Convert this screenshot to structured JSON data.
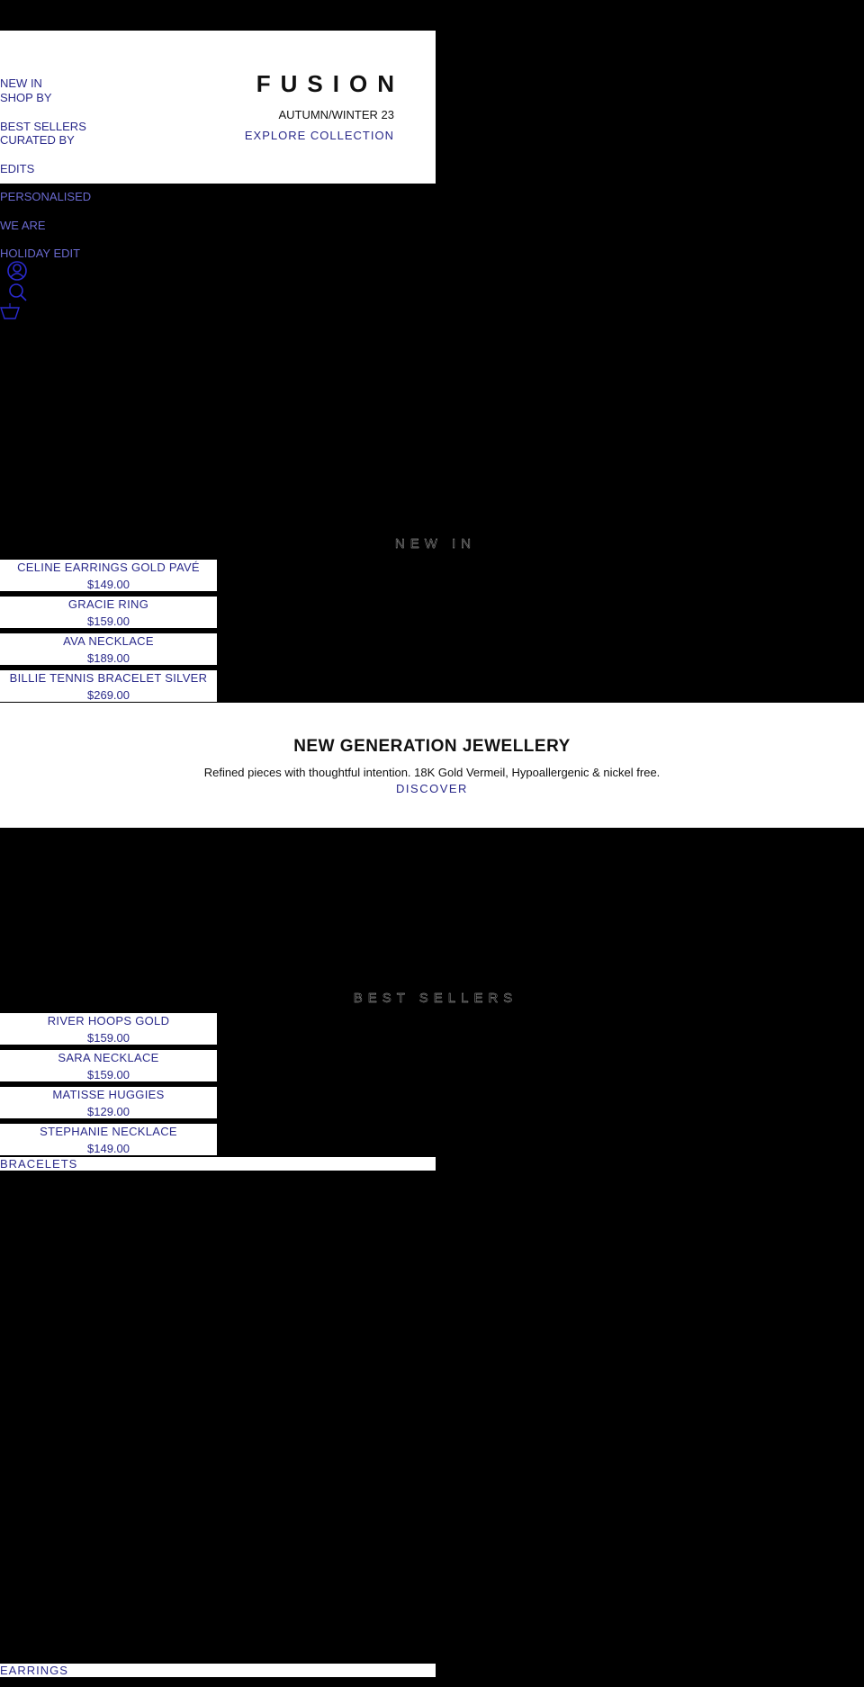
{
  "nav": {
    "items": [
      "NEW IN",
      "SHOP BY",
      "BEST SELLERS",
      "CURATED BY",
      "EDITS",
      "PERSONALISED",
      "WE ARE",
      "HOLIDAY EDIT"
    ]
  },
  "header": {
    "logo": "FUSION",
    "season": "AUTUMN/WINTER 23",
    "cta": "EXPLORE COLLECTION"
  },
  "icons": [
    "account-icon",
    "search-icon",
    "basket-icon"
  ],
  "new_in": {
    "title": "NEW IN",
    "products": [
      {
        "name": "CELINE EARRINGS GOLD PAVÉ",
        "price": "$149.00"
      },
      {
        "name": "GRACIE RING",
        "price": "$159.00"
      },
      {
        "name": "AVA NECKLACE",
        "price": "$189.00"
      },
      {
        "name": "BILLIE TENNIS BRACELET SILVER",
        "price": "$269.00"
      }
    ]
  },
  "banner": {
    "title": "NEW GENERATION JEWELLERY",
    "text": "Refined pieces with thoughtful intention. 18K Gold Vermeil, Hypoallergenic & nickel free.",
    "cta": "DISCOVER"
  },
  "best_sellers": {
    "title": "BEST SELLERS",
    "products": [
      {
        "name": "RIVER HOOPS GOLD",
        "price": "$159.00"
      },
      {
        "name": "SARA NECKLACE",
        "price": "$159.00"
      },
      {
        "name": "MATISSE HUGGIES",
        "price": "$129.00"
      },
      {
        "name": "STEPHANIE NECKLACE",
        "price": "$149.00"
      }
    ]
  },
  "categories": [
    "BRACELETS",
    "EARRINGS"
  ],
  "colors": {
    "link": "#2a2a8a",
    "background": "#000000",
    "panel": "#ffffff"
  }
}
